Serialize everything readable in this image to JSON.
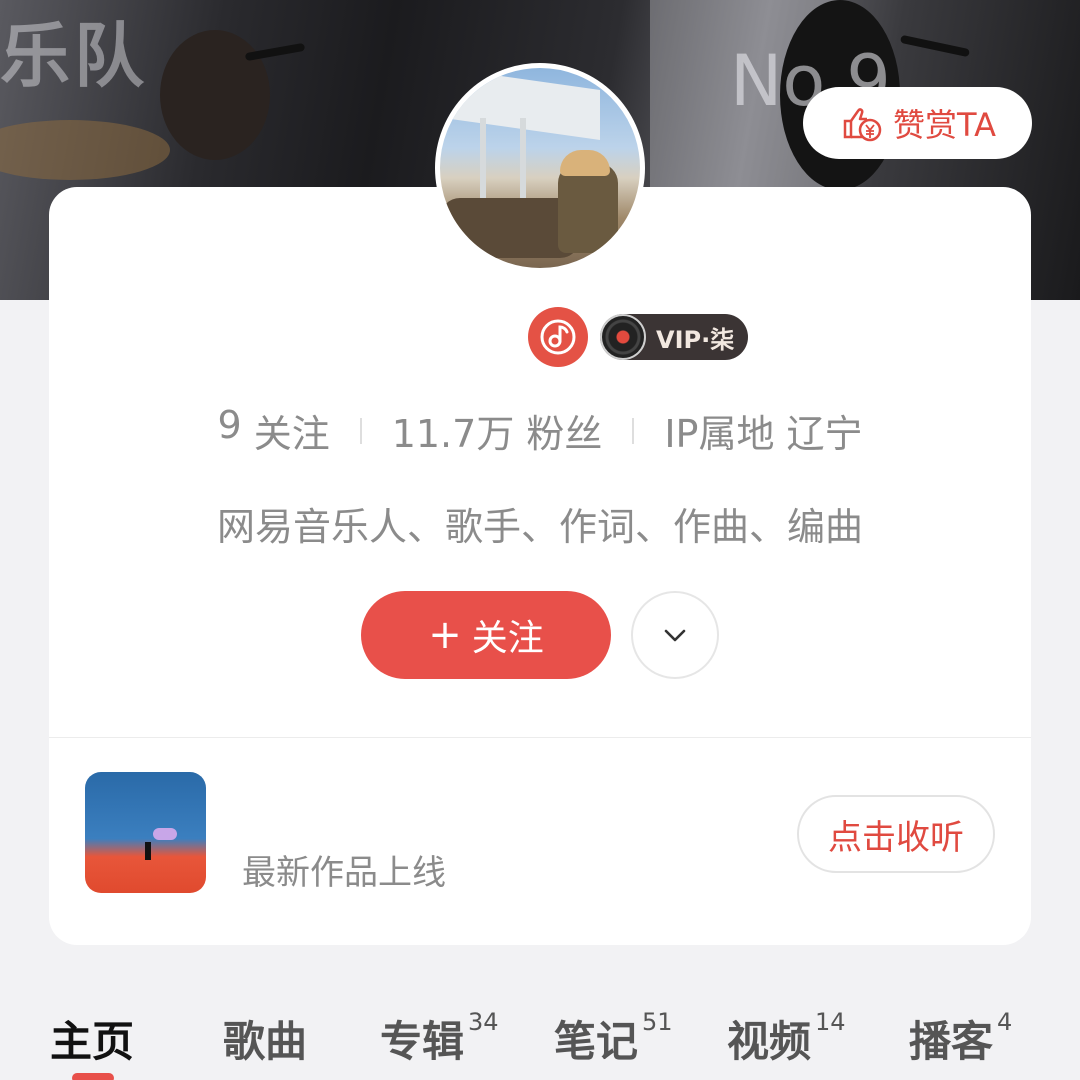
{
  "cover": {
    "text_left": "乐队",
    "text_right": "No.9"
  },
  "tip_button": {
    "label": "赞赏TA",
    "icon": "thumbs-up-yen-icon"
  },
  "badges": {
    "music_icon": "music-note-icon",
    "vip_label": "VIP·柒"
  },
  "stats": {
    "following": {
      "count": "9",
      "label": "关注"
    },
    "fans": {
      "count": "11.7万",
      "label": "粉丝"
    },
    "ip": {
      "label": "IP属地",
      "value": "辽宁"
    }
  },
  "bio": "网易音乐人、歌手、作词、作曲、编曲",
  "actions": {
    "follow_plus": "+",
    "follow_label": "关注",
    "more_icon": "chevron-down-icon"
  },
  "latest": {
    "text": "最新作品上线",
    "button": "点击收听"
  },
  "tabs": [
    {
      "label": "主页",
      "count": ""
    },
    {
      "label": "歌曲",
      "count": ""
    },
    {
      "label": "专辑",
      "count": "34"
    },
    {
      "label": "笔记",
      "count": "51"
    },
    {
      "label": "视频",
      "count": "14"
    },
    {
      "label": "播客",
      "count": "4"
    }
  ],
  "colors": {
    "accent": "#e8504a",
    "text_gray": "#8b8b8b"
  }
}
